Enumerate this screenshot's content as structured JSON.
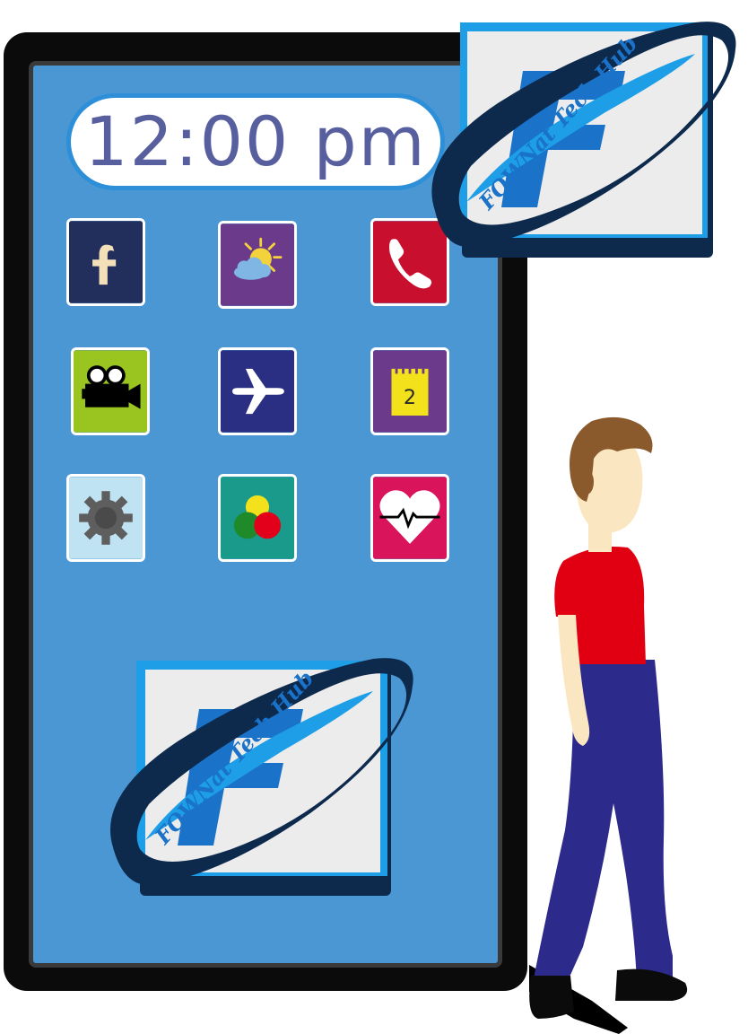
{
  "clock": {
    "time": "12:00 pm"
  },
  "apps": [
    {
      "name": "facebook-app",
      "icon": "facebook-f-icon",
      "bg": "#222e5c",
      "glyph": "f"
    },
    {
      "name": "weather-app",
      "icon": "sun-cloud-icon",
      "bg": "#6b3a8b"
    },
    {
      "name": "phone-app",
      "icon": "phone-handset-icon",
      "bg": "#c8102e"
    },
    {
      "name": "video-app",
      "icon": "video-camera-icon",
      "bg": "#9ac41f"
    },
    {
      "name": "flight-app",
      "icon": "airplane-icon",
      "bg": "#2a2f83"
    },
    {
      "name": "calendar-app",
      "icon": "notepad-icon",
      "bg": "#6b3a8b",
      "number": "2"
    },
    {
      "name": "settings-app",
      "icon": "gear-icon",
      "bg": "#bfe3f3"
    },
    {
      "name": "color-app",
      "icon": "color-circles-icon",
      "bg": "#1a9a8a"
    },
    {
      "name": "health-app",
      "icon": "heart-pulse-icon",
      "bg": "#d9145a"
    }
  ],
  "logo": {
    "letter": "F",
    "wordmark": "FOWNat Tech Hub",
    "colors": {
      "ring": "#0d2a4d",
      "letter": "#1a72c9",
      "frame": "#1d9ee6",
      "panel": "#ececec",
      "wordmark": "#1a72c9"
    }
  },
  "colors": {
    "screen": "#4a97d4",
    "clock_text": "#585f9f",
    "clock_border": "#2d8fd8",
    "shirt": "#e00012",
    "pants": "#2c2a8a",
    "hair": "#8a5a2c",
    "skin": "#fbe6c2"
  }
}
